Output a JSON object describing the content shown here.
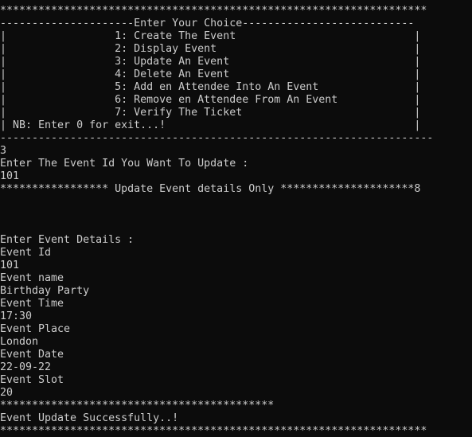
{
  "console": {
    "lines": [
      "*******************************************************************",
      "---------------------Enter Your Choice---------------------------",
      "|                 1: Create The Event                            |",
      "|                 2: Display Event                               |",
      "|                 3: Update An Event                             |",
      "|                 4: Delete An Event                             |",
      "|                 5: Add en Attendee Into An Event               |",
      "|                 6: Remove en Attendee From An Event            |",
      "|                 7: Verify The Ticket                           |",
      "| NB: Enter 0 for exit...!                                       |",
      "--------------------------------------------------------------------",
      "3",
      "Enter The Event Id You Want To Update :",
      "101",
      "***************** Update Event details Only *********************8",
      "",
      "",
      "",
      "Enter Event Details :",
      "Event Id",
      "101",
      "Event name",
      "Birthday Party",
      "Event Time",
      "17:30",
      "Event Place",
      "London",
      "Event Date",
      "22-09-22",
      "Event Slot",
      "20",
      "*******************************************",
      "Event Update Successfully..!",
      "*******************************************************************"
    ]
  }
}
